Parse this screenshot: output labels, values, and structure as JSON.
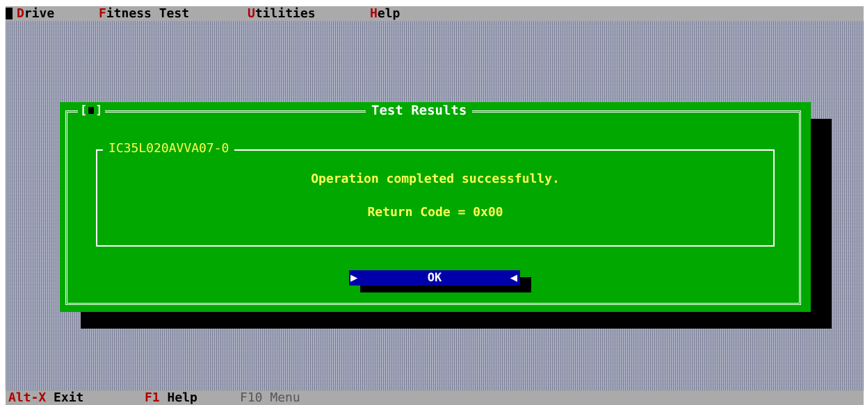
{
  "menubar": {
    "items": [
      {
        "hotkey": "D",
        "rest": "rive"
      },
      {
        "hotkey": "F",
        "rest": "itness Test"
      },
      {
        "hotkey": "U",
        "rest": "tilities"
      },
      {
        "hotkey": "H",
        "rest": "elp"
      }
    ]
  },
  "dialog": {
    "title": "Test Results",
    "close_left": "[",
    "close_right": "]",
    "group_label": "IC35L020AVVA07-0",
    "message": "Operation completed successfully.",
    "return_code": "Return Code = 0x00",
    "ok_label": "OK",
    "ok_arrow_left": "▶",
    "ok_arrow_right": "◀"
  },
  "statusbar": {
    "items": [
      {
        "key": "Alt-X",
        "label": "Exit"
      },
      {
        "key": "F1",
        "label": "Help"
      },
      {
        "key": "F10",
        "label": "Menu",
        "dimmed": true
      }
    ]
  },
  "colors": {
    "desktop": "#9aa0b2",
    "dialog_bg": "#00a800",
    "menu_bg": "#aaaaaa",
    "hotkey": "#b00000",
    "message_text": "#ffff55",
    "button_bg": "#0000aa"
  }
}
